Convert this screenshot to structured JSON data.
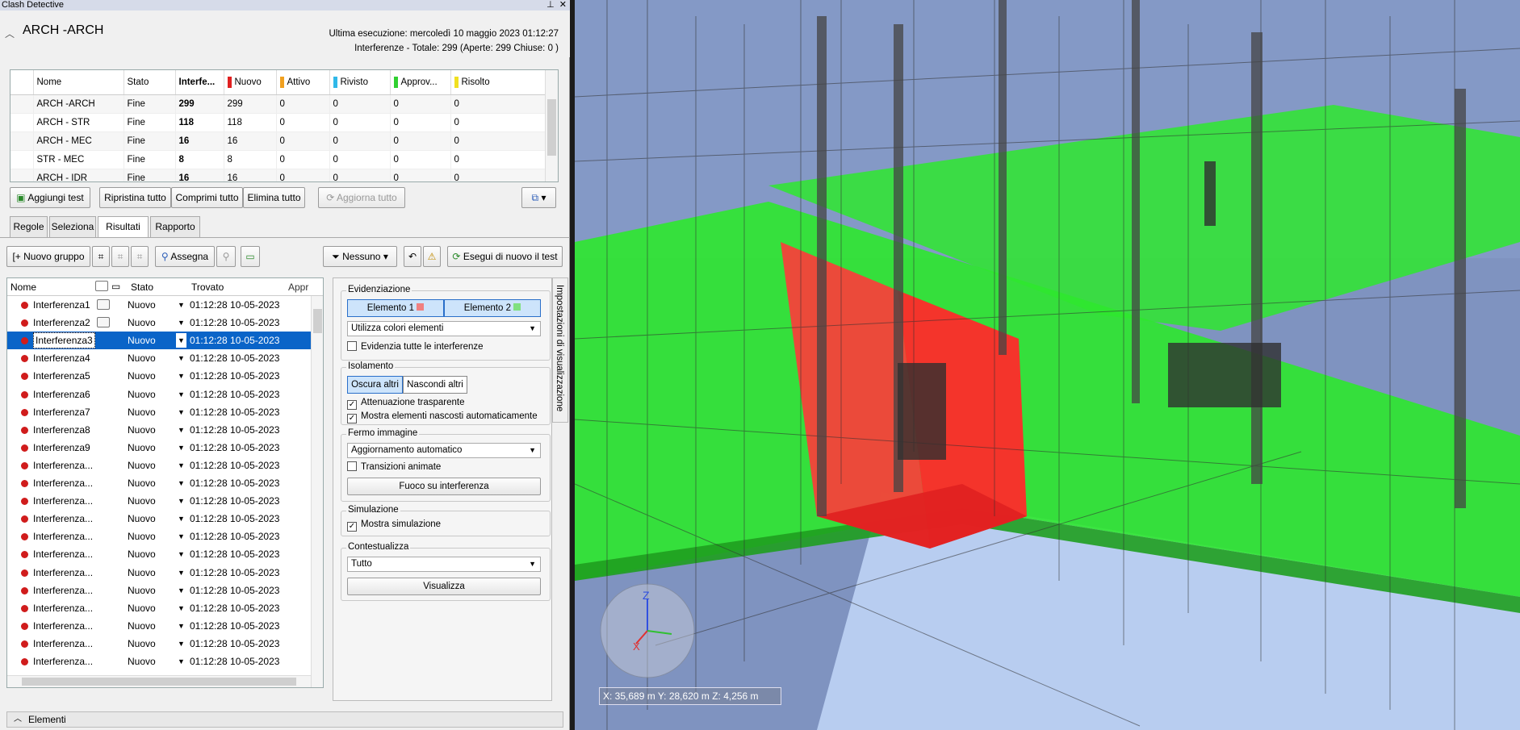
{
  "window": {
    "title": "Clash Detective"
  },
  "header": {
    "test_name": "ARCH -ARCH",
    "last_run_label": "Ultima esecuzione:",
    "last_run_value": "mercoledì 10 maggio 2023 01:12:27",
    "totals_text": "Interferenze - Totale:  299  (Aperte:  299  Chiuse:  0 )"
  },
  "tests_grid": {
    "columns": [
      "Nome",
      "Stato",
      "Interfe...",
      "Nuovo",
      "Attivo",
      "Rivisto",
      "Approv...",
      "Risolto"
    ],
    "column_colors": {
      "Nuovo": "#e02020",
      "Attivo": "#f0a020",
      "Rivisto": "#30b8e8",
      "Approv...": "#30d030",
      "Risolto": "#f0e020"
    },
    "rows": [
      {
        "name": "ARCH -ARCH",
        "stato": "Fine",
        "interf": "299",
        "nuovo": "299",
        "attivo": "0",
        "rivisto": "0",
        "approv": "0",
        "risolto": "0"
      },
      {
        "name": "ARCH - STR",
        "stato": "Fine",
        "interf": "118",
        "nuovo": "118",
        "attivo": "0",
        "rivisto": "0",
        "approv": "0",
        "risolto": "0"
      },
      {
        "name": "ARCH - MEC",
        "stato": "Fine",
        "interf": "16",
        "nuovo": "16",
        "attivo": "0",
        "rivisto": "0",
        "approv": "0",
        "risolto": "0"
      },
      {
        "name": "STR - MEC",
        "stato": "Fine",
        "interf": "8",
        "nuovo": "8",
        "attivo": "0",
        "rivisto": "0",
        "approv": "0",
        "risolto": "0"
      },
      {
        "name": "ARCH - IDR",
        "stato": "Fine",
        "interf": "16",
        "nuovo": "16",
        "attivo": "0",
        "rivisto": "0",
        "approv": "0",
        "risolto": "0"
      }
    ]
  },
  "test_buttons": {
    "add": "Aggiungi test",
    "reset_all": "Ripristina tutto",
    "compress_all": "Comprimi tutto",
    "delete_all": "Elimina tutto",
    "update_all": "Aggiorna tutto"
  },
  "tabs": [
    "Regole",
    "Seleziona",
    "Risultati",
    "Rapporto"
  ],
  "results_toolbar": {
    "new_group": "Nuovo gruppo",
    "assign": "Assegna",
    "filter": "Nessuno",
    "rerun": "Esegui di nuovo il test"
  },
  "results": {
    "columns": [
      "Nome",
      "Stato",
      "Trovato",
      "Appr"
    ],
    "rows": [
      {
        "name": "Interferenza1",
        "status": "Nuovo",
        "found": "01:12:28 10-05-2023"
      },
      {
        "name": "Interferenza2",
        "status": "Nuovo",
        "found": "01:12:28 10-05-2023"
      },
      {
        "name": "Interferenza3",
        "status": "Nuovo",
        "found": "01:12:28 10-05-2023"
      },
      {
        "name": "Interferenza4",
        "status": "Nuovo",
        "found": "01:12:28 10-05-2023"
      },
      {
        "name": "Interferenza5",
        "status": "Nuovo",
        "found": "01:12:28 10-05-2023"
      },
      {
        "name": "Interferenza6",
        "status": "Nuovo",
        "found": "01:12:28 10-05-2023"
      },
      {
        "name": "Interferenza7",
        "status": "Nuovo",
        "found": "01:12:28 10-05-2023"
      },
      {
        "name": "Interferenza8",
        "status": "Nuovo",
        "found": "01:12:28 10-05-2023"
      },
      {
        "name": "Interferenza9",
        "status": "Nuovo",
        "found": "01:12:28 10-05-2023"
      },
      {
        "name": "Interferenza...",
        "status": "Nuovo",
        "found": "01:12:28 10-05-2023"
      },
      {
        "name": "Interferenza...",
        "status": "Nuovo",
        "found": "01:12:28 10-05-2023"
      },
      {
        "name": "Interferenza...",
        "status": "Nuovo",
        "found": "01:12:28 10-05-2023"
      },
      {
        "name": "Interferenza...",
        "status": "Nuovo",
        "found": "01:12:28 10-05-2023"
      },
      {
        "name": "Interferenza...",
        "status": "Nuovo",
        "found": "01:12:28 10-05-2023"
      },
      {
        "name": "Interferenza...",
        "status": "Nuovo",
        "found": "01:12:28 10-05-2023"
      },
      {
        "name": "Interferenza...",
        "status": "Nuovo",
        "found": "01:12:28 10-05-2023"
      },
      {
        "name": "Interferenza...",
        "status": "Nuovo",
        "found": "01:12:28 10-05-2023"
      },
      {
        "name": "Interferenza...",
        "status": "Nuovo",
        "found": "01:12:28 10-05-2023"
      },
      {
        "name": "Interferenza...",
        "status": "Nuovo",
        "found": "01:12:28 10-05-2023"
      },
      {
        "name": "Interferenza...",
        "status": "Nuovo",
        "found": "01:12:28 10-05-2023"
      },
      {
        "name": "Interferenza...",
        "status": "Nuovo",
        "found": "01:12:28 10-05-2023"
      },
      {
        "name": "Interferenza...",
        "status": "Nuovo",
        "found": "01:12:28 10-05-2023"
      }
    ],
    "selected_index": 2
  },
  "settings": {
    "side_tab": "Impostazioni di visualizzazione",
    "highlight": {
      "title": "Evidenziazione",
      "element1": "Elemento 1",
      "element2": "Elemento 2",
      "element1_color": "#f08080",
      "element2_color": "#80e080",
      "color_mode": "Utilizza colori elementi",
      "highlight_all": "Evidenzia tutte le interferenze"
    },
    "isolation": {
      "title": "Isolamento",
      "dim_others": "Oscura altri",
      "hide_others": "Nascondi altri",
      "transparent_dimming": "Attenuazione trasparente",
      "auto_reveal": "Mostra elementi nascosti automaticamente"
    },
    "viewpoint": {
      "title": "Fermo immagine",
      "mode": "Aggiornamento automatico",
      "animate": "Transizioni animate",
      "focus": "Fuoco su interferenza"
    },
    "simulation": {
      "title": "Simulazione",
      "show": "Mostra simulazione"
    },
    "context": {
      "title": "Contestualizza",
      "mode": "Tutto",
      "view": "Visualizza"
    }
  },
  "elements_panel": {
    "label": "Elementi"
  },
  "viewport": {
    "coords": "X: 35,689 m  Y: 28,620 m  Z: 4,256 m",
    "colors": {
      "clash1": "#ff3a3a",
      "clash2": "#2ee82e",
      "sky": "#b8cdf0"
    }
  }
}
